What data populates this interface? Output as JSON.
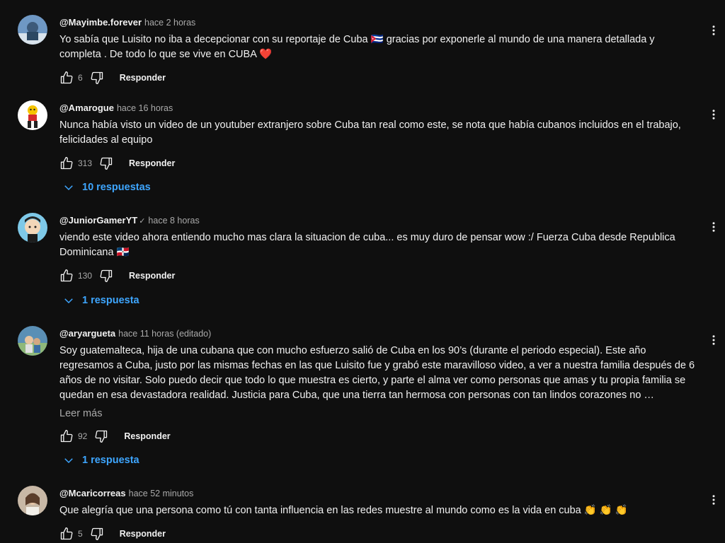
{
  "ui": {
    "reply_label": "Responder",
    "colors": {
      "background": "#0f0f0f",
      "text": "#f1f1f1",
      "muted": "#aaaaaa",
      "link": "#3ea6ff",
      "heart": "#e74c3c"
    }
  },
  "comments": [
    {
      "author": "@Mayimbe.forever",
      "time": "hace 2 horas",
      "text": "Yo sabía que Luisito no iba a decepcionar con su reportaje de Cuba 🇨🇺 gracias por exponerle al mundo de una manera detallada y completa . De todo lo que se vive en CUBA ❤️",
      "likes": "6"
    },
    {
      "author": "@Amarogue",
      "time": "hace 16 horas",
      "text": "Nunca había visto un video de un youtuber extranjero sobre Cuba tan real como este, se nota que había cubanos incluidos en el trabajo, felicidades al equipo",
      "likes": "313",
      "replies": "10 respuestas"
    },
    {
      "author": "@JuniorGamerYT",
      "verified": "✓",
      "time": "hace 8 horas",
      "text": "viendo este video ahora entiendo mucho mas clara la situacion de cuba... es muy duro de pensar wow :/ Fuerza Cuba desde Republica Dominicana 🇩🇴",
      "likes": "130",
      "replies": "1 respuesta"
    },
    {
      "author": "@aryargueta",
      "time": "hace 11 horas (editado)",
      "text": "Soy guatemalteca, hija de una cubana que con mucho esfuerzo salió de Cuba en los 90’s (durante el periodo especial). Este año regresamos a Cuba, justo por las mismas fechas en las que Luisito fue y grabó este maravilloso video, a ver a nuestra familia después de 6 años de no visitar. Solo puedo decir que todo lo que muestra es cierto, y parte el alma ver como personas que amas y tu propia familia se quedan en esa devastadora realidad. Justicia para Cuba, que una tierra tan hermosa con personas con tan lindos corazones no …",
      "read_more": "Leer más",
      "likes": "92",
      "replies": "1 respuesta"
    },
    {
      "author": "@Mcaricorreas",
      "time": "hace 52 minutos",
      "text": "Que alegría que una persona como tú con tanta influencia en las redes muestre al mundo como es la vida en cuba 👏 👏 👏",
      "likes": "5"
    }
  ]
}
